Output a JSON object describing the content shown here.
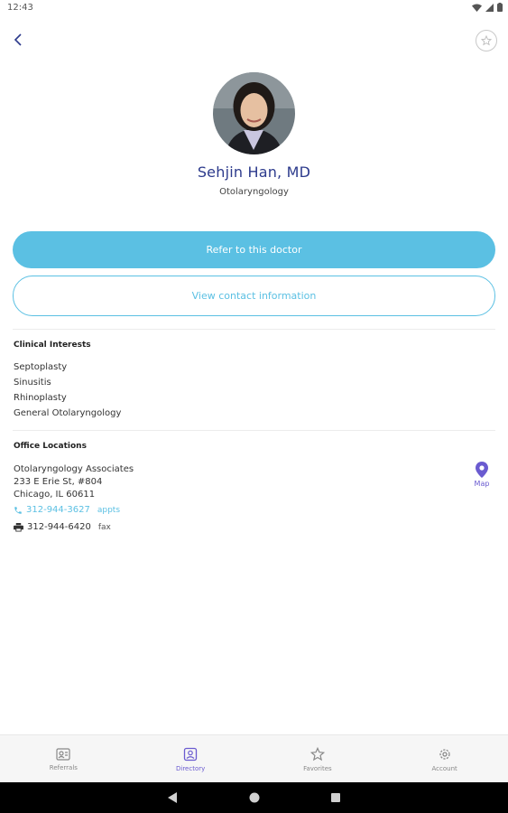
{
  "status_bar": {
    "time": "12:43"
  },
  "header": {
    "back_icon": "chevron-left-icon",
    "favorite_icon": "star-icon"
  },
  "doctor": {
    "name": "Sehjin Han, MD",
    "specialty": "Otolaryngology"
  },
  "actions": {
    "refer_label": "Refer to this doctor",
    "contact_label": "View contact information"
  },
  "clinical_interests": {
    "title": "Clinical Interests",
    "items": [
      "Septoplasty",
      "Sinusitis",
      "Rhinoplasty",
      "General Otolaryngology"
    ]
  },
  "office_locations": {
    "title": "Office Locations",
    "practice": "Otolaryngology Associates",
    "address_line1": "233 E Erie St, #804",
    "address_line2": "Chicago, IL 60611",
    "phone": "312-944-3627",
    "phone_note": "appts",
    "fax": "312-944-6420",
    "fax_note": "fax",
    "map_label": "Map"
  },
  "bottom_nav": [
    {
      "label": "Referrals",
      "icon": "referrals-icon"
    },
    {
      "label": "Directory",
      "icon": "directory-icon",
      "active": true
    },
    {
      "label": "Favorites",
      "icon": "star-icon"
    },
    {
      "label": "Account",
      "icon": "gear-icon"
    }
  ],
  "colors": {
    "accent": "#5bc0e3",
    "name": "#2c3a8c",
    "purple": "#6a5bd0"
  }
}
